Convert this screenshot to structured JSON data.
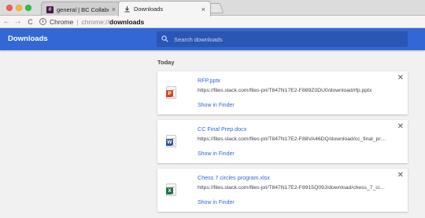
{
  "tabs": [
    {
      "title": "general | BC Collaborative Cor",
      "favicon": "slack-icon",
      "active": false
    },
    {
      "title": "Downloads",
      "favicon": "download-icon",
      "active": true
    }
  ],
  "address": {
    "chip": "Chrome",
    "scheme": "chrome://",
    "host": "downloads"
  },
  "header": {
    "title": "Downloads",
    "search_placeholder": "Search downloads"
  },
  "section": {
    "label": "Today"
  },
  "downloads": [
    {
      "name": "RFP.pptx",
      "url": "https://files.slack.com/files-pri/T847N17E2-F889Z0DU0/download/rfp.pptx",
      "action": "Show in Finder",
      "type_badge": "P",
      "type_color": "#d24726"
    },
    {
      "name": "CC Final Prep.docx",
      "url": "https://files.slack.com/files-pri/T847N17E2-F88VA46DQ/download/cc_final_prep.d...",
      "action": "Show in Finder",
      "type_badge": "W",
      "type_color": "#2b579a"
    },
    {
      "name": "Chess 7 circles program.xlsx",
      "url": "https://files.slack.com/files-pri/T847N17E2-F8915Q09J/download/chess_7_circle...",
      "action": "Show in Finder",
      "type_badge": "X",
      "type_color": "#217346"
    }
  ],
  "colors": {
    "accent": "#3367d6",
    "search_bg": "#2a56b4",
    "page_bg": "#f1f1f1"
  }
}
